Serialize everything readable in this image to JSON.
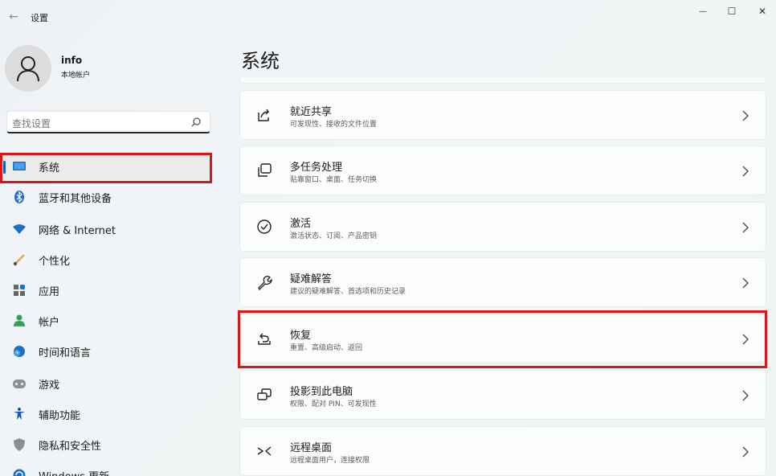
{
  "titlebar": {
    "app_title": "设置",
    "back_glyph": "←",
    "minimize_glyph": "—",
    "maximize_glyph": "☐",
    "close_glyph": "✕"
  },
  "profile": {
    "name": "info",
    "account_type": "本地帐户"
  },
  "search": {
    "placeholder": "查找设置"
  },
  "nav": {
    "items": [
      {
        "label": "系统",
        "icon": "monitor-icon",
        "selected": true
      },
      {
        "label": "蓝牙和其他设备",
        "icon": "bluetooth-icon"
      },
      {
        "label": "网络 & Internet",
        "icon": "wifi-icon"
      },
      {
        "label": "个性化",
        "icon": "brush-icon"
      },
      {
        "label": "应用",
        "icon": "apps-icon"
      },
      {
        "label": "帐户",
        "icon": "person-icon"
      },
      {
        "label": "时间和语言",
        "icon": "globe-clock-icon"
      },
      {
        "label": "游戏",
        "icon": "gamepad-icon"
      },
      {
        "label": "辅助功能",
        "icon": "accessibility-icon"
      },
      {
        "label": "隐私和安全性",
        "icon": "shield-icon"
      },
      {
        "label": "Windows 更新",
        "icon": "update-icon"
      }
    ]
  },
  "main": {
    "title": "系统",
    "cards": [
      {
        "title": "就近共享",
        "subtitle": "可发现性、接收的文件位置",
        "icon": "share-icon"
      },
      {
        "title": "多任务处理",
        "subtitle": "贴靠窗口、桌面、任务切换",
        "icon": "multitask-icon"
      },
      {
        "title": "激活",
        "subtitle": "激活状态、订阅、产品密钥",
        "icon": "check-circle-icon"
      },
      {
        "title": "疑难解答",
        "subtitle": "建议的疑难解答、首选项和历史记录",
        "icon": "wrench-icon"
      },
      {
        "title": "恢复",
        "subtitle": "重置、高级启动、返回",
        "icon": "recovery-icon"
      },
      {
        "title": "投影到此电脑",
        "subtitle": "权限、配对 PIN、可发现性",
        "icon": "project-icon"
      },
      {
        "title": "远程桌面",
        "subtitle": "远程桌面用户，连接权限",
        "icon": "remote-desktop-icon"
      }
    ]
  },
  "colors": {
    "accent": "#0067c0",
    "highlight": "#e01414"
  }
}
